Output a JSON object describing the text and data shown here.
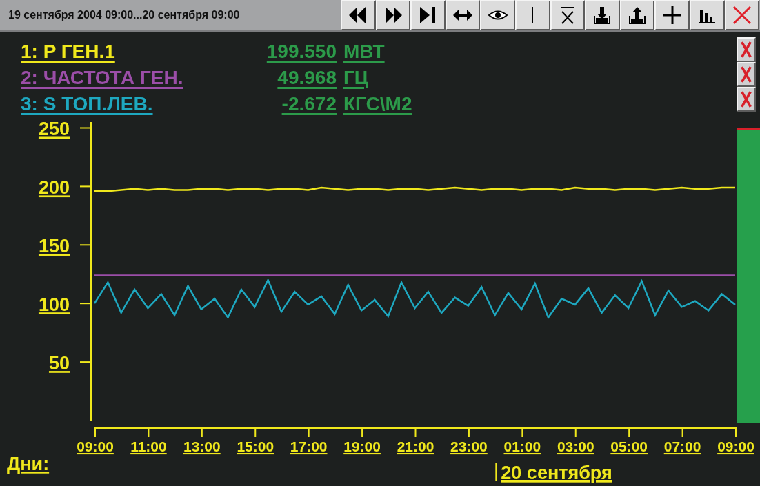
{
  "toolbar": {
    "title": "19 сентября 2004 09:00...20 сентября 09:00",
    "buttons": [
      {
        "kind": "rewind"
      },
      {
        "kind": "forward"
      },
      {
        "kind": "end"
      },
      {
        "kind": "fit"
      },
      {
        "kind": "eye"
      },
      {
        "kind": "cursor"
      },
      {
        "kind": "mean"
      },
      {
        "kind": "import"
      },
      {
        "kind": "export"
      },
      {
        "kind": "add"
      },
      {
        "kind": "bars"
      },
      {
        "kind": "close"
      }
    ]
  },
  "legend": [
    {
      "value": "199.550",
      "unit": "МВТ"
    },
    {
      "value": "49.968",
      "unit": "ГЦ"
    },
    {
      "value": "-2.672",
      "unit": "КГС\\М2"
    }
  ],
  "remove_buttons": [
    {
      "kind": "remove"
    },
    {
      "kind": "remove"
    },
    {
      "kind": "remove"
    }
  ],
  "chart_data": {
    "type": "line",
    "xlabel": "Дни:",
    "ylim": [
      0,
      255
    ],
    "yticks": [
      50,
      100,
      150,
      200,
      250
    ],
    "annotations": [
      "20 сентября"
    ],
    "categories": [
      "09:00",
      null,
      null,
      null,
      "11:00",
      null,
      null,
      null,
      "13:00",
      null,
      null,
      null,
      "15:00",
      null,
      null,
      null,
      "17:00",
      null,
      null,
      null,
      "19:00",
      null,
      null,
      null,
      "21:00",
      null,
      null,
      null,
      "23:00",
      null,
      null,
      null,
      "01:00",
      null,
      null,
      null,
      "03:00",
      null,
      null,
      null,
      "05:00",
      null,
      null,
      null,
      "07:00",
      null,
      null,
      null,
      "09:00"
    ],
    "series": [
      {
        "name": "1: P ГЕН.1",
        "color": "#f0e81c",
        "values": [
          196,
          196,
          197,
          198,
          197,
          198,
          197,
          197,
          198,
          198,
          197,
          198,
          198,
          197,
          198,
          198,
          197,
          199,
          198,
          197,
          198,
          198,
          197,
          198,
          198,
          197,
          198,
          199,
          198,
          197,
          198,
          198,
          197,
          198,
          198,
          197,
          199,
          198,
          198,
          197,
          198,
          198,
          197,
          198,
          199,
          198,
          198,
          199,
          199
        ]
      },
      {
        "name": "2: ЧАСТОТА ГЕН.",
        "color": "#9b4ea8",
        "values": [
          124,
          124,
          124,
          124,
          124,
          124,
          124,
          124,
          124,
          124,
          124,
          124,
          124,
          124,
          124,
          124,
          124,
          124,
          124,
          124,
          124,
          124,
          124,
          124,
          124,
          124,
          124,
          124,
          124,
          124,
          124,
          124,
          124,
          124,
          124,
          124,
          124,
          124,
          124,
          124,
          124,
          124,
          124,
          124,
          124,
          124,
          124,
          124,
          124
        ]
      },
      {
        "name": "3: S ТОП.ЛЕВ.",
        "color": "#1ea8c0",
        "values": [
          100,
          118,
          92,
          112,
          96,
          108,
          90,
          115,
          95,
          104,
          88,
          112,
          97,
          120,
          93,
          110,
          99,
          106,
          91,
          116,
          94,
          103,
          89,
          118,
          96,
          110,
          92,
          105,
          98,
          114,
          90,
          109,
          95,
          117,
          88,
          104,
          99,
          113,
          92,
          107,
          96,
          119,
          90,
          111,
          97,
          102,
          94,
          108,
          99
        ]
      }
    ]
  }
}
